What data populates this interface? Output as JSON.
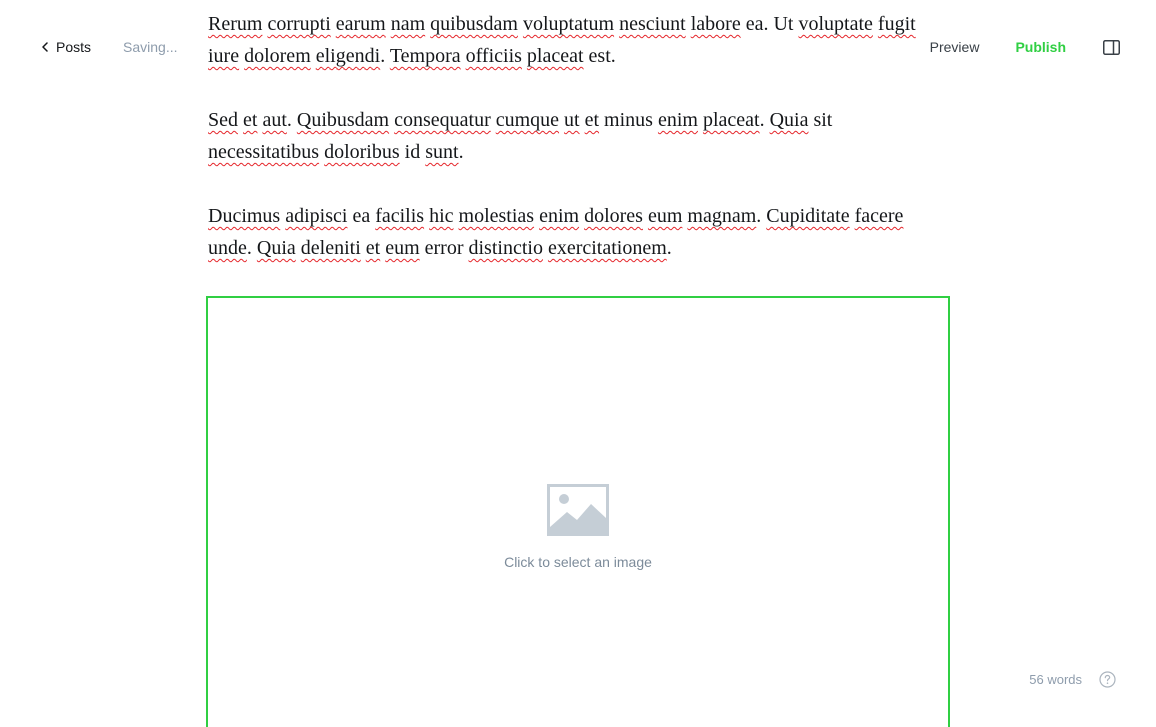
{
  "topbar": {
    "back_label": "Posts",
    "status": "Saving...",
    "preview_label": "Preview",
    "publish_label": "Publish"
  },
  "editor": {
    "paragraphs": [
      {
        "lines": [
          [
            {
              "t": "Rerum",
              "s": true
            },
            {
              "t": " "
            },
            {
              "t": "corrupti",
              "s": true
            },
            {
              "t": " "
            },
            {
              "t": "earum",
              "s": true
            },
            {
              "t": " "
            },
            {
              "t": "nam",
              "s": true
            },
            {
              "t": " "
            },
            {
              "t": "quibusdam",
              "s": true
            },
            {
              "t": " "
            },
            {
              "t": "voluptatum",
              "s": true
            },
            {
              "t": " "
            },
            {
              "t": "nesciunt",
              "s": true
            },
            {
              "t": " "
            },
            {
              "t": "labore",
              "s": true
            },
            {
              "t": " ea. Ut "
            },
            {
              "t": "voluptate",
              "s": true
            },
            {
              "t": " "
            },
            {
              "t": "fugit",
              "s": true
            }
          ],
          [
            {
              "t": "iure",
              "s": true
            },
            {
              "t": " "
            },
            {
              "t": "dolorem",
              "s": true
            },
            {
              "t": " "
            },
            {
              "t": "eligendi",
              "s": true
            },
            {
              "t": ". "
            },
            {
              "t": "Tempora",
              "s": true
            },
            {
              "t": " "
            },
            {
              "t": "officiis",
              "s": true
            },
            {
              "t": " "
            },
            {
              "t": "placeat",
              "s": true
            },
            {
              "t": " est."
            }
          ]
        ]
      },
      {
        "lines": [
          [
            {
              "t": "Sed",
              "s": true
            },
            {
              "t": " "
            },
            {
              "t": "et",
              "s": true
            },
            {
              "t": " "
            },
            {
              "t": "aut",
              "s": true
            },
            {
              "t": ". "
            },
            {
              "t": "Quibusdam",
              "s": true
            },
            {
              "t": " "
            },
            {
              "t": "consequatur",
              "s": true
            },
            {
              "t": " "
            },
            {
              "t": "cumque",
              "s": true
            },
            {
              "t": " "
            },
            {
              "t": "ut",
              "s": true
            },
            {
              "t": " "
            },
            {
              "t": "et",
              "s": true
            },
            {
              "t": " minus "
            },
            {
              "t": "enim",
              "s": true
            },
            {
              "t": " "
            },
            {
              "t": "placeat",
              "s": true
            },
            {
              "t": ". "
            },
            {
              "t": "Quia",
              "s": true
            },
            {
              "t": " sit"
            }
          ],
          [
            {
              "t": "necessitatibus",
              "s": true
            },
            {
              "t": " "
            },
            {
              "t": "doloribus",
              "s": true
            },
            {
              "t": " id "
            },
            {
              "t": "sunt",
              "s": true
            },
            {
              "t": "."
            }
          ]
        ]
      },
      {
        "lines": [
          [
            {
              "t": "Ducimus",
              "s": true
            },
            {
              "t": " "
            },
            {
              "t": "adipisci",
              "s": true
            },
            {
              "t": " ea "
            },
            {
              "t": "facilis",
              "s": true
            },
            {
              "t": " "
            },
            {
              "t": "hic",
              "s": true
            },
            {
              "t": " "
            },
            {
              "t": "molestias",
              "s": true
            },
            {
              "t": " "
            },
            {
              "t": "enim",
              "s": true
            },
            {
              "t": " "
            },
            {
              "t": "dolores",
              "s": true
            },
            {
              "t": " "
            },
            {
              "t": "eum",
              "s": true
            },
            {
              "t": " "
            },
            {
              "t": "magnam",
              "s": true
            },
            {
              "t": ". "
            },
            {
              "t": "Cupiditate",
              "s": true
            },
            {
              "t": " "
            },
            {
              "t": "facere",
              "s": true
            }
          ],
          [
            {
              "t": "unde",
              "s": true
            },
            {
              "t": ". "
            },
            {
              "t": "Quia",
              "s": true
            },
            {
              "t": " "
            },
            {
              "t": "deleniti",
              "s": true
            },
            {
              "t": " "
            },
            {
              "t": "et",
              "s": true
            },
            {
              "t": " "
            },
            {
              "t": "eum",
              "s": true
            },
            {
              "t": " error "
            },
            {
              "t": "distinctio",
              "s": true
            },
            {
              "t": " "
            },
            {
              "t": "exercitationem",
              "s": true
            },
            {
              "t": "."
            }
          ]
        ]
      }
    ]
  },
  "image_card": {
    "hint": "Click to select an image",
    "icon": "image-placeholder-icon"
  },
  "footer": {
    "word_count": "56 words",
    "help_icon": "help-circle-icon"
  },
  "colors": {
    "accent_green": "#30cf43",
    "muted_text": "#8e9cac",
    "spellcheck_red": "#e5252a",
    "icon_gray": "#c5ced6"
  }
}
